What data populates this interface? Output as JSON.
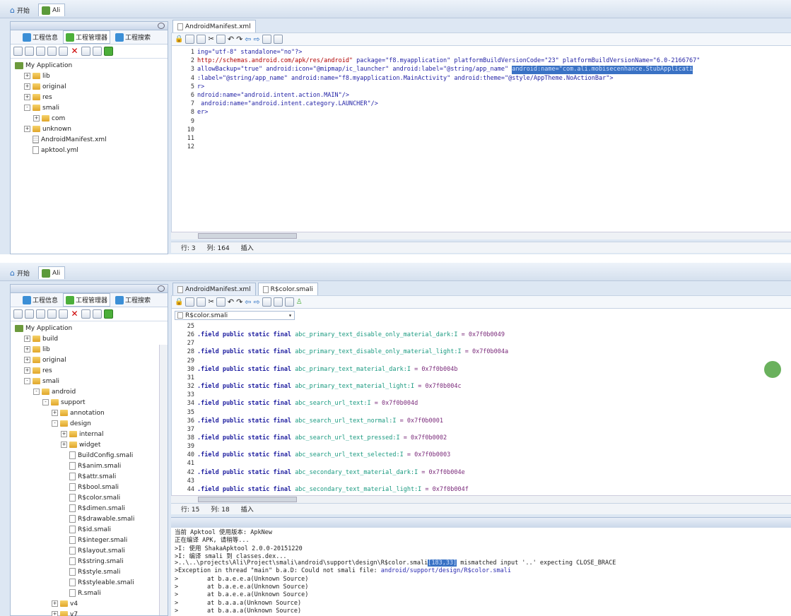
{
  "top": {
    "home_tab": "开始",
    "project_tab": "Ali",
    "left_tabs": [
      "工程信息",
      "工程管理器",
      "工程搜索"
    ],
    "tree_root": "My Application"
  },
  "panel1": {
    "editor_tabs": [
      "AndroidManifest.xml"
    ],
    "tree": [
      {
        "label": "lib",
        "type": "folder",
        "level": 1,
        "pm": "+"
      },
      {
        "label": "original",
        "type": "folder",
        "level": 1,
        "pm": "+"
      },
      {
        "label": "res",
        "type": "folder",
        "level": 1,
        "pm": "+"
      },
      {
        "label": "smali",
        "type": "folder",
        "level": 1,
        "pm": "-"
      },
      {
        "label": "com",
        "type": "folder",
        "level": 2,
        "pm": "+"
      },
      {
        "label": "unknown",
        "type": "folder",
        "level": 1,
        "pm": "+"
      },
      {
        "label": "AndroidManifest.xml",
        "type": "xml",
        "level": 1,
        "pm": ""
      },
      {
        "label": "apktool.yml",
        "type": "file",
        "level": 1,
        "pm": ""
      }
    ],
    "code_lines": [
      {
        "n": "1",
        "parts": [
          {
            "t": "ing=\"utf-8\" standalone=\"no\"?>",
            "c": "s"
          }
        ]
      },
      {
        "n": "2",
        "parts": [
          {
            "t": "http://schemas.android.com/apk/res/android\"",
            "c": "r"
          },
          {
            "t": " package=\"f8.myapplication\" platformBuildVersionCode=\"23\" platformBuildVersionName=\"6.0-2166767\"",
            "c": "s"
          }
        ]
      },
      {
        "n": "3",
        "parts": [
          {
            "t": "allowBackup=\"true\" android:icon=\"@mipmap/ic_launcher\" android:label=\"@string/app_name\" ",
            "c": "s"
          },
          {
            "t": "android:name=\"com.ali.mobisecenhance.StubApplicati",
            "c": "sel"
          }
        ]
      },
      {
        "n": "4",
        "parts": [
          {
            "t": ":label=\"@string/app_name\" android:name=\"f8.myapplication.MainActivity\" android:theme=\"@style/AppTheme.NoActionBar\">",
            "c": "s"
          }
        ]
      },
      {
        "n": "5",
        "parts": [
          {
            "t": "r>",
            "c": "s"
          }
        ]
      },
      {
        "n": "6",
        "parts": [
          {
            "t": "ndroid:name=\"android.intent.action.MAIN\"/>",
            "c": "s"
          }
        ]
      },
      {
        "n": "7",
        "parts": [
          {
            "t": " android:name=\"android.intent.category.LAUNCHER\"/>",
            "c": "s"
          }
        ]
      },
      {
        "n": "8",
        "parts": [
          {
            "t": "er>",
            "c": "s"
          }
        ]
      },
      {
        "n": "9",
        "parts": []
      },
      {
        "n": "10",
        "parts": []
      },
      {
        "n": "11",
        "parts": []
      },
      {
        "n": "12",
        "parts": []
      }
    ],
    "status": {
      "row": "行: 3",
      "col": "列: 164",
      "mode": "插入"
    }
  },
  "panel2": {
    "editor_tabs": [
      "AndroidManifest.xml",
      "R$color.smali"
    ],
    "file_select": "R$color.smali",
    "tree": [
      {
        "label": "build",
        "type": "folder",
        "level": 1,
        "pm": "+"
      },
      {
        "label": "lib",
        "type": "folder",
        "level": 1,
        "pm": "+"
      },
      {
        "label": "original",
        "type": "folder",
        "level": 1,
        "pm": "+"
      },
      {
        "label": "res",
        "type": "folder",
        "level": 1,
        "pm": "+"
      },
      {
        "label": "smali",
        "type": "folder",
        "level": 1,
        "pm": "-"
      },
      {
        "label": "android",
        "type": "folder",
        "level": 2,
        "pm": "-"
      },
      {
        "label": "support",
        "type": "folder",
        "level": 3,
        "pm": "-"
      },
      {
        "label": "annotation",
        "type": "folder",
        "level": 4,
        "pm": "+"
      },
      {
        "label": "design",
        "type": "folder",
        "level": 4,
        "pm": "-"
      },
      {
        "label": "internal",
        "type": "folder",
        "level": 5,
        "pm": "+"
      },
      {
        "label": "widget",
        "type": "folder",
        "level": 5,
        "pm": "+"
      },
      {
        "label": "BuildConfig.smali",
        "type": "file",
        "level": 5,
        "pm": ""
      },
      {
        "label": "R$anim.smali",
        "type": "file",
        "level": 5,
        "pm": ""
      },
      {
        "label": "R$attr.smali",
        "type": "file",
        "level": 5,
        "pm": ""
      },
      {
        "label": "R$bool.smali",
        "type": "file",
        "level": 5,
        "pm": ""
      },
      {
        "label": "R$color.smali",
        "type": "file",
        "level": 5,
        "pm": ""
      },
      {
        "label": "R$dimen.smali",
        "type": "file",
        "level": 5,
        "pm": ""
      },
      {
        "label": "R$drawable.smali",
        "type": "file",
        "level": 5,
        "pm": ""
      },
      {
        "label": "R$id.smali",
        "type": "file",
        "level": 5,
        "pm": ""
      },
      {
        "label": "R$integer.smali",
        "type": "file",
        "level": 5,
        "pm": ""
      },
      {
        "label": "R$layout.smali",
        "type": "file",
        "level": 5,
        "pm": ""
      },
      {
        "label": "R$string.smali",
        "type": "file",
        "level": 5,
        "pm": ""
      },
      {
        "label": "R$style.smali",
        "type": "file",
        "level": 5,
        "pm": ""
      },
      {
        "label": "R$styleable.smali",
        "type": "file",
        "level": 5,
        "pm": ""
      },
      {
        "label": "R.smali",
        "type": "file",
        "level": 5,
        "pm": ""
      },
      {
        "label": "v4",
        "type": "folder",
        "level": 4,
        "pm": "+"
      },
      {
        "label": "v7",
        "type": "folder",
        "level": 4,
        "pm": "+"
      }
    ],
    "code_lines": [
      {
        "n": "25",
        "name": "",
        "val": ""
      },
      {
        "n": "26",
        "name": "abc_primary_text_disable_only_material_dark:I",
        "val": "0x7f0b0049"
      },
      {
        "n": "27",
        "name": "",
        "val": ""
      },
      {
        "n": "28",
        "name": "abc_primary_text_disable_only_material_light:I",
        "val": "0x7f0b004a"
      },
      {
        "n": "29",
        "name": "",
        "val": ""
      },
      {
        "n": "30",
        "name": "abc_primary_text_material_dark:I",
        "val": "0x7f0b004b"
      },
      {
        "n": "31",
        "name": "",
        "val": ""
      },
      {
        "n": "32",
        "name": "abc_primary_text_material_light:I",
        "val": "0x7f0b004c"
      },
      {
        "n": "33",
        "name": "",
        "val": ""
      },
      {
        "n": "34",
        "name": "abc_search_url_text:I",
        "val": "0x7f0b004d"
      },
      {
        "n": "35",
        "name": "",
        "val": ""
      },
      {
        "n": "36",
        "name": "abc_search_url_text_normal:I",
        "val": "0x7f0b0001"
      },
      {
        "n": "37",
        "name": "",
        "val": ""
      },
      {
        "n": "38",
        "name": "abc_search_url_text_pressed:I",
        "val": "0x7f0b0002"
      },
      {
        "n": "39",
        "name": "",
        "val": ""
      },
      {
        "n": "40",
        "name": "abc_search_url_text_selected:I",
        "val": "0x7f0b0003"
      },
      {
        "n": "41",
        "name": "",
        "val": ""
      },
      {
        "n": "42",
        "name": "abc_secondary_text_material_dark:I",
        "val": "0x7f0b004e"
      },
      {
        "n": "43",
        "name": "",
        "val": ""
      },
      {
        "n": "44",
        "name": "abc_secondary_text_material_light:I",
        "val": "0x7f0b004f"
      }
    ],
    "field_keyword": ".field public static final",
    "status": {
      "row": "行: 15",
      "col": "列: 18",
      "mode": "插入"
    },
    "console": [
      {
        "t": "当前 Apktool 使用版本: ApkNew"
      },
      {
        "t": "正在编译 APK, 请稍等..."
      },
      {
        "t": ">I: 使用 ShakaApktool 2.0.0-20151220"
      },
      {
        "t": ">I: 编译 smali 到 classes.dex..."
      },
      {
        "t": ">..\\..\\projects\\Ali\\Project\\smali\\android\\support\\design\\R$color.smali",
        "hl": "[183,33]",
        "rest": " mismatched input '..' expecting CLOSE_BRACE"
      },
      {
        "t": ">Exception in thread \"main\" b.a.D: Could not smali file: ",
        "blue": "android/support/design/R$color.smali"
      },
      {
        "t": ">        at b.a.e.e.a(Unknown Source)"
      },
      {
        "t": ">        at b.a.e.e.a(Unknown Source)"
      },
      {
        "t": ">        at b.a.e.e.a(Unknown Source)"
      },
      {
        "t": ">        at b.a.a.a(Unknown Source)"
      },
      {
        "t": ">        at b.a.a.a(Unknown Source)"
      }
    ]
  }
}
